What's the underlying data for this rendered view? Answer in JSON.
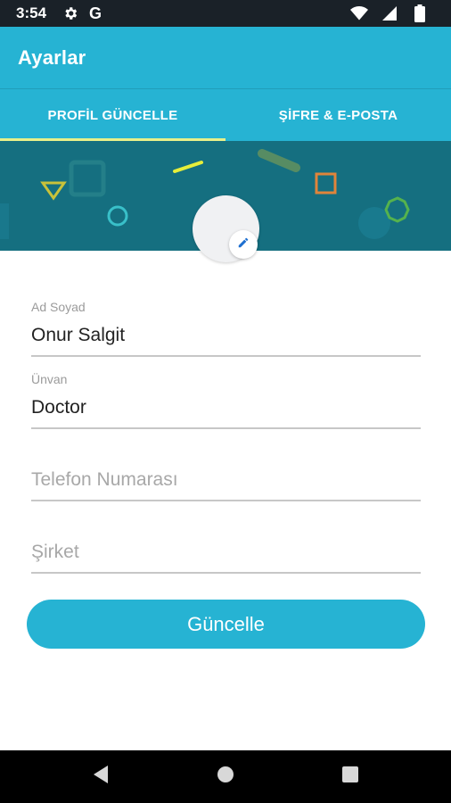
{
  "status_bar": {
    "time": "3:54",
    "left_icons": [
      "gear-icon",
      "google-icon"
    ],
    "google_letter": "G",
    "right_icons": [
      "wifi-icon",
      "signal-icon",
      "battery-icon"
    ]
  },
  "app_bar": {
    "title": "Ayarlar",
    "color": "#26b3d3"
  },
  "tabs": [
    {
      "label": "PROFİL GÜNCELLE",
      "active": true
    },
    {
      "label": "ŞİFRE & E-POSTA",
      "active": false
    }
  ],
  "profile": {
    "avatar": "avatar",
    "edit_icon": "pencil-icon"
  },
  "form": {
    "name": {
      "label": "Ad Soyad",
      "value": "Onur Salgit"
    },
    "title": {
      "label": "Ünvan",
      "value": "Doctor"
    },
    "phone": {
      "placeholder": "Telefon Numarası"
    },
    "company": {
      "placeholder": "Şirket"
    }
  },
  "update_button": {
    "label": "Güncelle"
  },
  "nav_bar": {
    "icons": [
      "back-icon",
      "home-icon",
      "recents-icon"
    ]
  }
}
